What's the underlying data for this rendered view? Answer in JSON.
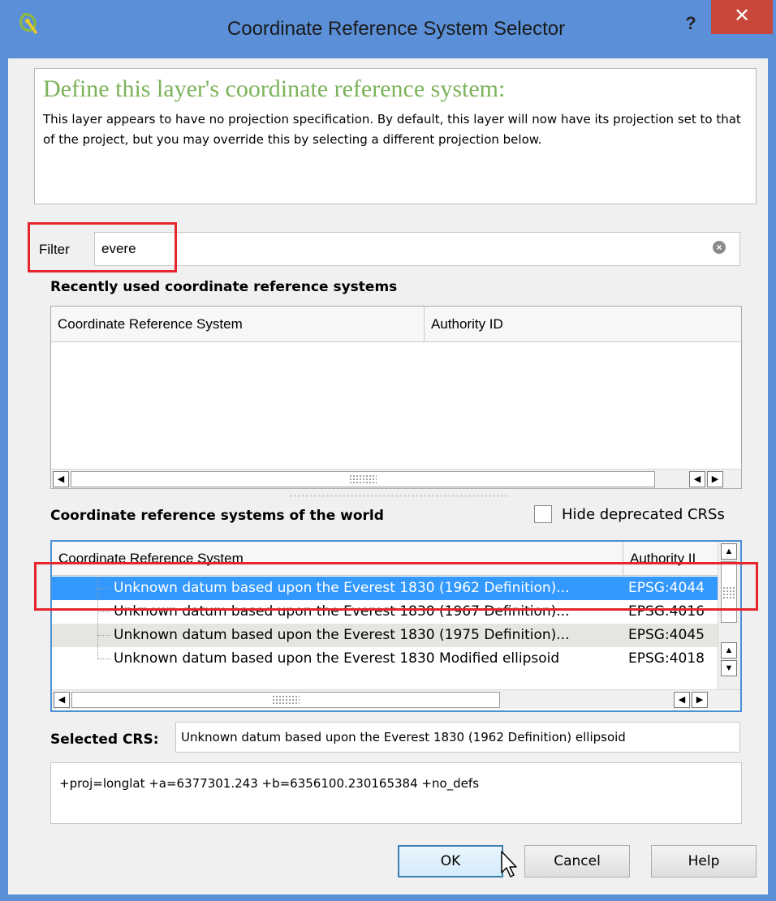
{
  "window": {
    "title": "Coordinate Reference System Selector",
    "help_label": "?",
    "close_label": "✕"
  },
  "info": {
    "heading": "Define this layer's coordinate reference system:",
    "body": "This layer appears to have no projection specification. By default, this layer will now have its projection set to that of the project, but you may override this by selecting a different projection below."
  },
  "filter": {
    "label": "Filter",
    "value": "evere"
  },
  "recent": {
    "label": "Recently used coordinate reference systems",
    "columns": [
      "Coordinate Reference System",
      "Authority ID"
    ]
  },
  "world": {
    "label": "Coordinate reference systems of the world",
    "hide_deprecated_label": "Hide deprecated CRSs",
    "hide_deprecated_checked": false,
    "columns": [
      "Coordinate Reference System",
      "Authority II"
    ],
    "rows": [
      {
        "name": "Unknown datum based upon the Everest 1830 (1962 Definition)...",
        "id": "EPSG:4044",
        "selected": true
      },
      {
        "name": "Unknown datum based upon the Everest 1830 (1967 Definition)...",
        "id": "EPSG:4016",
        "selected": false
      },
      {
        "name": "Unknown datum based upon the Everest 1830 (1975 Definition)...",
        "id": "EPSG:4045",
        "selected": false
      },
      {
        "name": "Unknown datum based upon the Everest 1830 Modified ellipsoid",
        "id": "EPSG:4018",
        "selected": false
      }
    ]
  },
  "selected": {
    "label": "Selected CRS:",
    "value": "Unknown datum based upon the Everest 1830 (1962 Definition) ellipsoid",
    "proj": "+proj=longlat +a=6377301.243 +b=6356100.230165384 +no_defs"
  },
  "buttons": {
    "ok": "OK",
    "cancel": "Cancel",
    "help": "Help"
  },
  "colors": {
    "titlebar": "#5b90d8",
    "close": "#c7473b",
    "selection": "#3399ff",
    "highlight": "#e6262c",
    "heading": "#7cb35a"
  }
}
